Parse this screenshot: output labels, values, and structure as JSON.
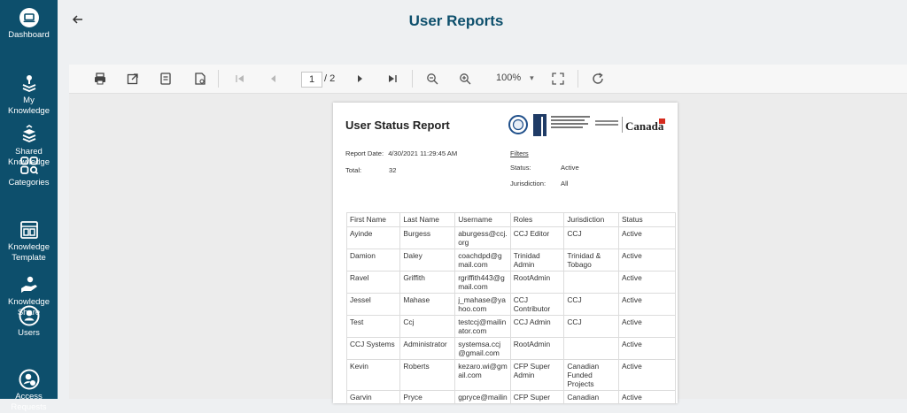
{
  "sidebar": {
    "items": [
      {
        "label": "Dashboard",
        "icon": "laptop-icon"
      },
      {
        "label": "My\nKnowledge",
        "icon": "knowledge-stack-icon"
      },
      {
        "label": "Shared\nKnowledge",
        "icon": "shared-stack-icon"
      },
      {
        "label": "Categories",
        "icon": "categories-grid-icon"
      },
      {
        "label": "Knowledge\nTemplate",
        "icon": "template-icon"
      },
      {
        "label": "Knowledge\nShare",
        "icon": "hand-share-icon"
      },
      {
        "label": "Users",
        "icon": "user-circle-icon"
      },
      {
        "label": "Access\nRequests",
        "icon": "access-request-icon"
      }
    ]
  },
  "header": {
    "title": "User Reports"
  },
  "toolbar": {
    "page_current": "1",
    "page_total": "/ 2",
    "zoom": "100%"
  },
  "report": {
    "title": "User Status Report",
    "logo_text": "JUDICIAL REFORM AND INSTITUTIONAL STRENGTHENING (JURIST) PROJECT",
    "funded_text": "Funded by the Government of Canada",
    "canada_text": "Canada",
    "report_date_label": "Report Date:",
    "report_date_value": "4/30/2021 11:29:45 AM",
    "total_label": "Total:",
    "total_value": "32",
    "filters_label": "Filters",
    "status_label": "Status:",
    "status_value": "Active",
    "jurisdiction_label": "Jurisdiction:",
    "jurisdiction_value": "All",
    "columns": [
      "First Name",
      "Last Name",
      "Username",
      "Roles",
      "Jurisdiction",
      "Status"
    ],
    "rows": [
      [
        "Ayinde",
        "Burgess",
        "aburgess@ccj.\norg",
        "CCJ Editor",
        "CCJ",
        "Active"
      ],
      [
        "Damion",
        "Daley",
        "coachdpd@g\nmail.com",
        "Trinidad Admin",
        "Trinidad &\nTobago",
        "Active"
      ],
      [
        "Ravel",
        "Griffith",
        "rgriffith443@g\nmail.com",
        "RootAdmin",
        "",
        "Active"
      ],
      [
        "Jessel",
        "Mahase",
        "j_mahase@ya\nhoo.com",
        "CCJ\nContributor",
        "CCJ",
        "Active"
      ],
      [
        "Test",
        "Ccj",
        "testccj@mailin\nator.com",
        "CCJ Admin",
        "CCJ",
        "Active"
      ],
      [
        "CCJ Systems",
        "Administrator",
        "systemsa.ccj\n@gmail.com",
        "RootAdmin",
        "",
        "Active"
      ],
      [
        "Kevin",
        "Roberts",
        "kezaro.wi@gm\nail.com",
        "CFP Super\nAdmin",
        "Canadian\nFunded\nProjects",
        "Active"
      ],
      [
        "Garvin",
        "Pryce",
        "gpryce@mailin",
        "CFP Super",
        "Canadian",
        "Active"
      ]
    ]
  },
  "colors": {
    "sidebar": "#0d4f6c",
    "title": "#0d4f6c",
    "background": "#eef0f2"
  }
}
